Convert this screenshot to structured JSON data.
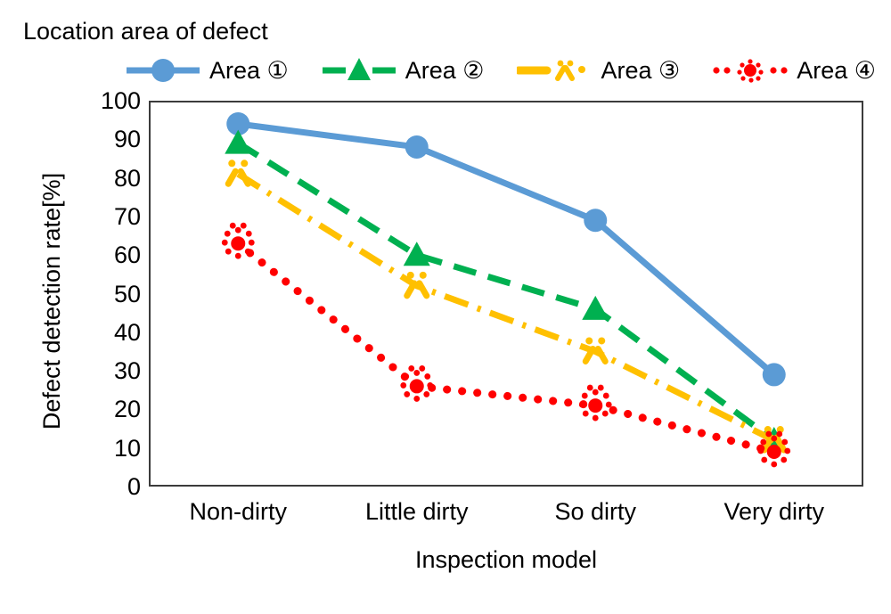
{
  "chart_data": {
    "type": "line",
    "title": "Location area of defect",
    "xlabel": "Inspection model",
    "ylabel": "Defect detection rate[%]",
    "categories": [
      "Non-dirty",
      "Little dirty",
      "So dirty",
      "Very dirty"
    ],
    "ylim": [
      0,
      100
    ],
    "yticks": [
      0,
      10,
      20,
      30,
      40,
      50,
      60,
      70,
      80,
      90,
      100
    ],
    "ytick_labels": [
      "0",
      "10",
      "20",
      "30",
      "40",
      "50",
      "60",
      "70",
      "80",
      "90",
      "100"
    ],
    "grid": false,
    "legend_position": "top",
    "series": [
      {
        "name": "Area ①",
        "color": "#5b9bd5",
        "marker": "circle",
        "line_style": "solid",
        "values": [
          94,
          88,
          69,
          29
        ]
      },
      {
        "name": "Area ②",
        "color": "#00b050",
        "marker": "triangle",
        "line_style": "dashed",
        "values": [
          89,
          60,
          46,
          12
        ]
      },
      {
        "name": "Area ③",
        "color": "#ffc000",
        "marker": "asterisk",
        "line_style": "dash-dot",
        "values": [
          81,
          52,
          35,
          12
        ]
      },
      {
        "name": "Area ④",
        "color": "#ff0000",
        "marker": "starburst",
        "line_style": "dotted",
        "values": [
          63,
          26,
          21,
          9
        ]
      }
    ]
  },
  "legend": {
    "items": [
      {
        "label": "Area ①"
      },
      {
        "label": "Area ②"
      },
      {
        "label": "Area ③"
      },
      {
        "label": "Area ④"
      }
    ]
  }
}
